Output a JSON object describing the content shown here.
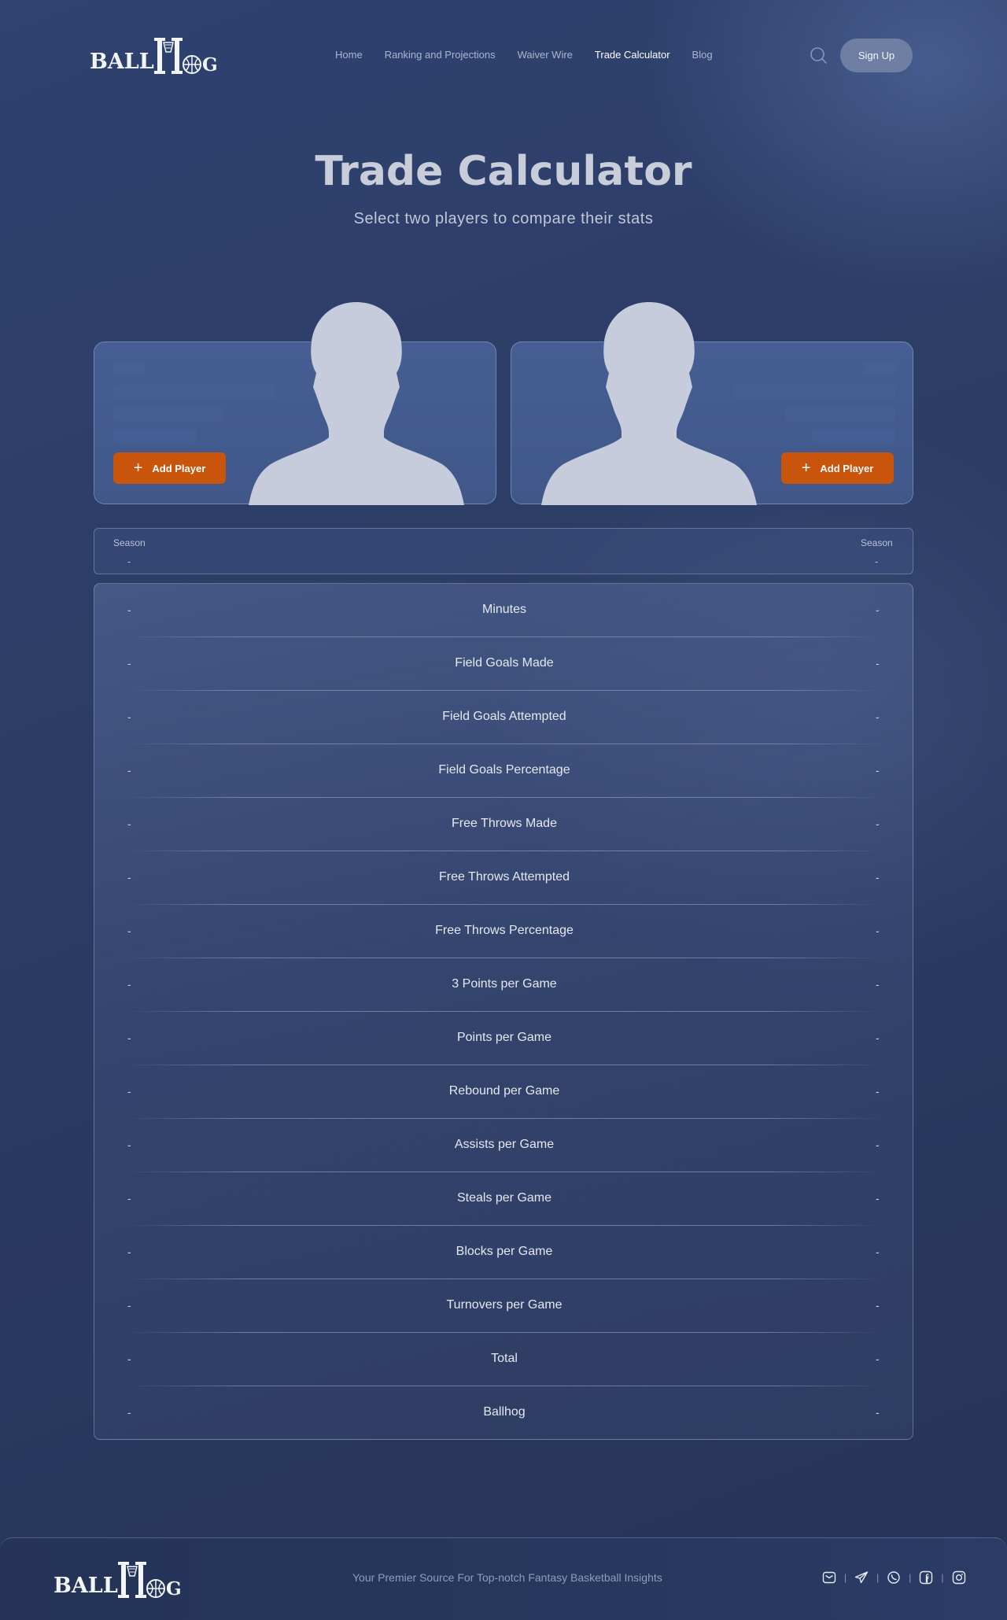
{
  "header": {
    "logo_text": "BALLHOG",
    "nav": [
      {
        "label": "Home"
      },
      {
        "label": "Ranking and Projections"
      },
      {
        "label": "Waiver Wire"
      },
      {
        "label": "Trade Calculator",
        "active": true
      },
      {
        "label": "Blog"
      }
    ],
    "search_icon": "search-icon",
    "signup_label": "Sign Up"
  },
  "hero": {
    "title": "Trade Calculator",
    "subtitle": "Select two players to compare their stats"
  },
  "players": {
    "left": {
      "add_label": "Add Player"
    },
    "right": {
      "add_label": "Add Player"
    }
  },
  "season": {
    "left_label": "Season",
    "left_value": "-",
    "right_label": "Season",
    "right_value": "-"
  },
  "stats": [
    {
      "name": "Minutes",
      "left": "-",
      "right": "-"
    },
    {
      "name": "Field Goals Made",
      "left": "-",
      "right": "-"
    },
    {
      "name": "Field Goals Attempted",
      "left": "-",
      "right": "-"
    },
    {
      "name": "Field Goals Percentage",
      "left": "-",
      "right": "-"
    },
    {
      "name": "Free Throws Made",
      "left": "-",
      "right": "-"
    },
    {
      "name": "Free Throws Attempted",
      "left": "-",
      "right": "-"
    },
    {
      "name": "Free Throws Percentage",
      "left": "-",
      "right": "-"
    },
    {
      "name": "3 Points per Game",
      "left": "-",
      "right": "-"
    },
    {
      "name": "Points per Game",
      "left": "-",
      "right": "-"
    },
    {
      "name": "Rebound per Game",
      "left": "-",
      "right": "-"
    },
    {
      "name": "Assists per Game",
      "left": "-",
      "right": "-"
    },
    {
      "name": "Steals per Game",
      "left": "-",
      "right": "-"
    },
    {
      "name": "Blocks per Game",
      "left": "-",
      "right": "-"
    },
    {
      "name": "Turnovers per Game",
      "left": "-",
      "right": "-"
    },
    {
      "name": "Total",
      "left": "-",
      "right": "-"
    },
    {
      "name": "Ballhog",
      "left": "-",
      "right": "-"
    }
  ],
  "footer": {
    "tagline": "Your Premier Source For Top-notch Fantasy Basketball Insights",
    "socials": [
      "email-icon",
      "telegram-icon",
      "whatsapp-icon",
      "facebook-icon",
      "instagram-icon"
    ]
  },
  "colors": {
    "accent": "#c9540c",
    "background": "#2c3d66",
    "card": "#445b8f"
  }
}
